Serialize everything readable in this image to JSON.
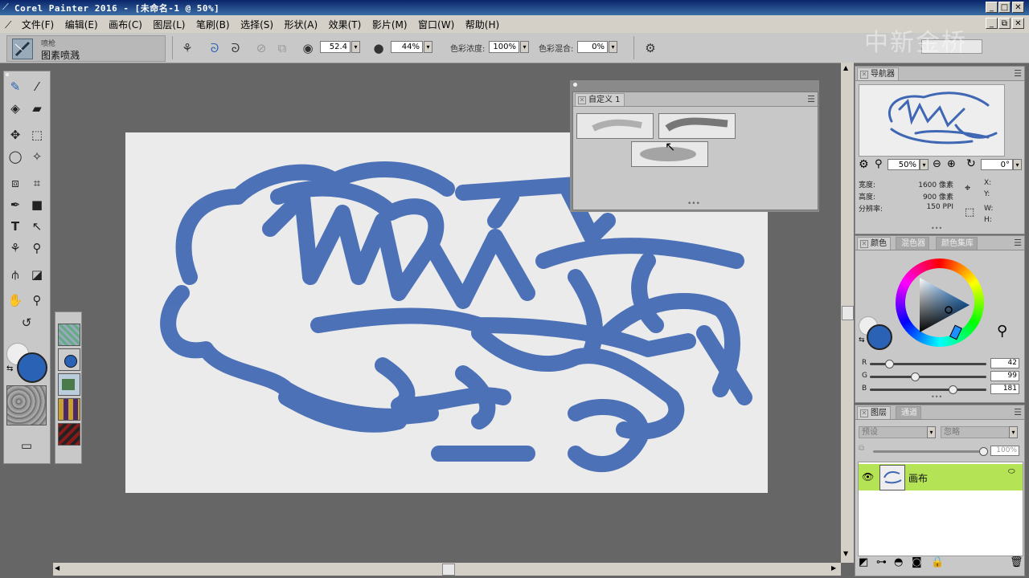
{
  "app": {
    "title": "Corel Painter 2016 - [未命名-1 @ 50%]"
  },
  "watermark": "中新金桥",
  "menu": [
    "文件(F)",
    "编辑(E)",
    "画布(C)",
    "图层(L)",
    "笔刷(B)",
    "选择(S)",
    "形状(A)",
    "效果(T)",
    "影片(M)",
    "窗口(W)",
    "帮助(H)"
  ],
  "brush": {
    "category": "喷枪",
    "variant": "图素喷溅"
  },
  "propbar": {
    "size": "52.4",
    "opacity": "44%",
    "color_density_label": "色彩浓度:",
    "color_density": "100%",
    "color_mix_label": "色彩混合:",
    "color_mix": "0%"
  },
  "custom_palette": {
    "tab": "自定义 1"
  },
  "navigator": {
    "tab": "导航器",
    "zoom": "50%",
    "rotation": "0°",
    "width_label": "宽度:",
    "width": "1600 像素",
    "height_label": "高度:",
    "height": "900 像素",
    "res_label": "分辨率:",
    "res": "150 PPI",
    "x": "X:",
    "y": "Y:",
    "w": "W:",
    "h": "H:"
  },
  "color_panel": {
    "tabs": [
      "颜色",
      "混色器",
      "颜色集库"
    ],
    "r_label": "R",
    "r": "42",
    "g_label": "G",
    "g": "99",
    "b_label": "B",
    "b": "181",
    "r_frac": 0.165,
    "g_frac": 0.388,
    "b_frac": 0.71,
    "main_color": "#2a63b5"
  },
  "layers_panel": {
    "tabs": [
      "图层",
      "通道"
    ],
    "preset": "预设",
    "composite": "忽略",
    "opacity": "100%",
    "layer_name": "画布"
  },
  "colors": {
    "accent": "#2a63b5",
    "layer_highlight": "#b5e356",
    "titlebar": "#0a246a"
  },
  "icons": {
    "close": "✕",
    "min": "_",
    "max": "□"
  }
}
